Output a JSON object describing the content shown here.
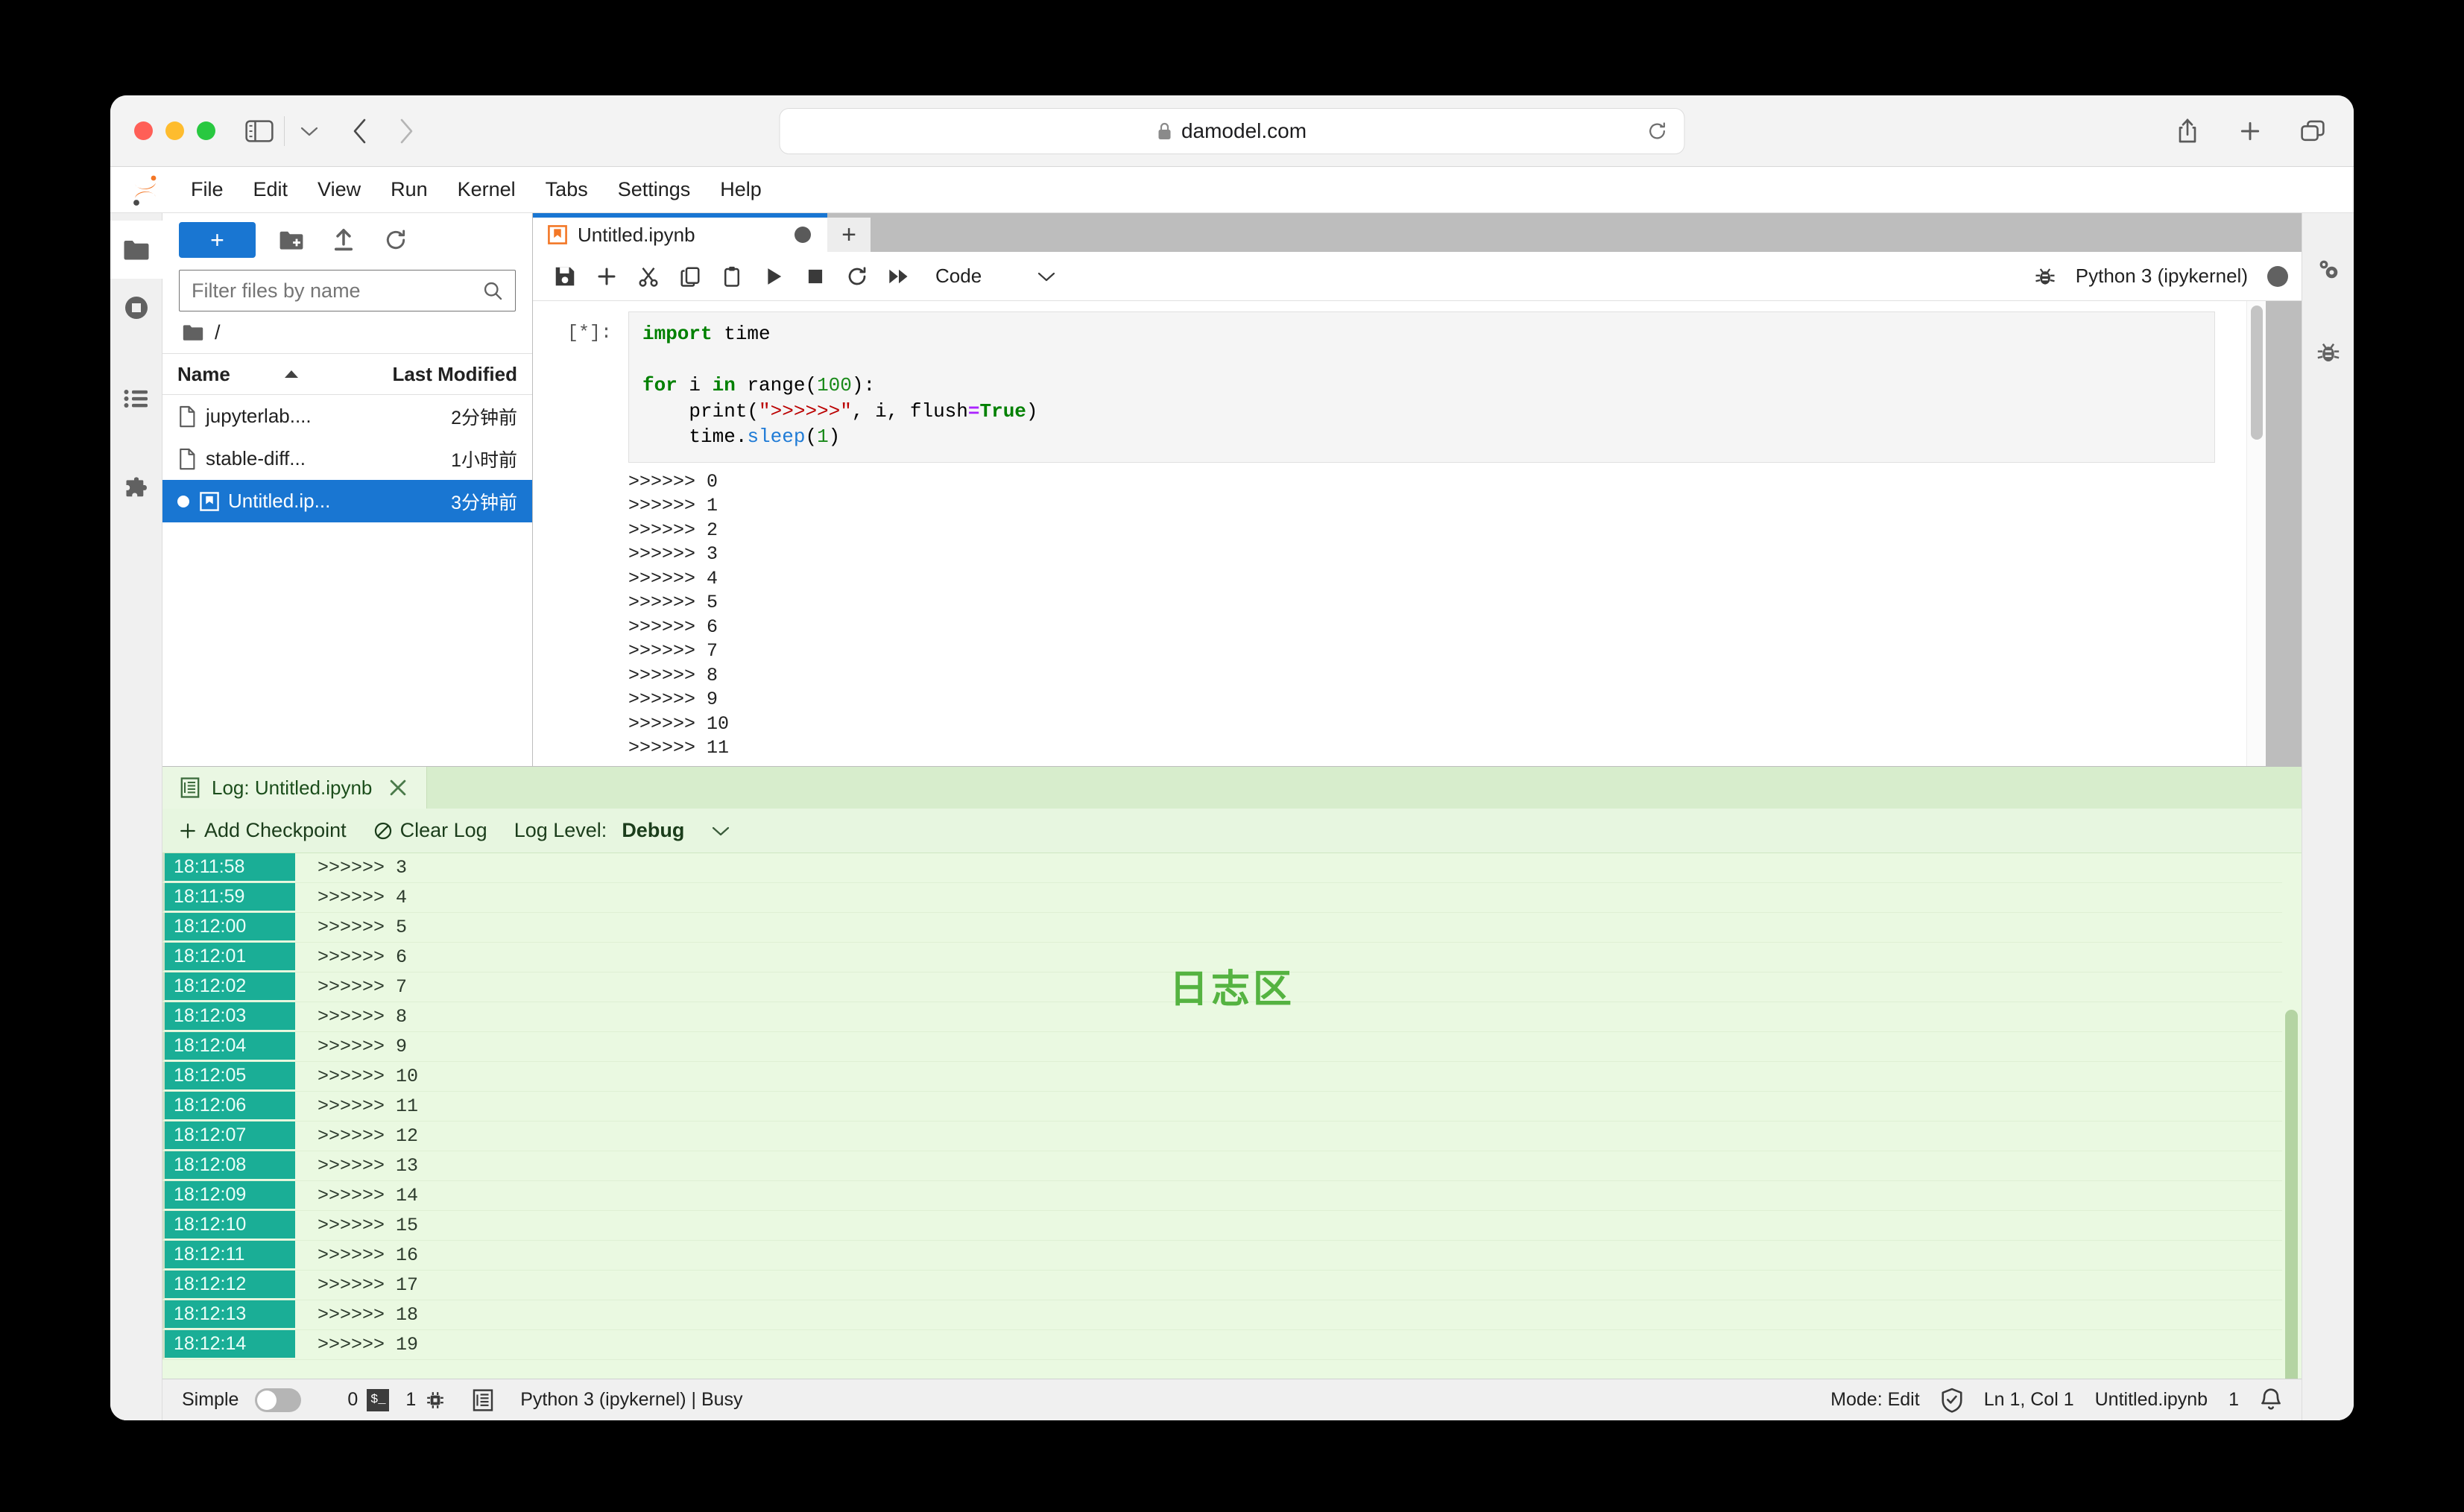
{
  "browser": {
    "url": "damodel.com",
    "lock_icon": "lock-icon",
    "reload_icon": "reload-icon",
    "sidebar_icon": "sidebar-toggle-icon",
    "back_icon": "back-arrow-icon",
    "forward_icon": "forward-arrow-icon",
    "share_icon": "share-icon",
    "newtab_icon": "plus-icon",
    "tabs_icon": "tab-overview-icon"
  },
  "menubar": {
    "items": [
      "File",
      "Edit",
      "View",
      "Run",
      "Kernel",
      "Tabs",
      "Settings",
      "Help"
    ]
  },
  "activity_bar": {
    "items": [
      {
        "name": "file-browser",
        "icon": "folder-icon"
      },
      {
        "name": "running-sessions",
        "icon": "stop-circle-icon"
      },
      {
        "name": "command-palette",
        "icon": "list-icon"
      },
      {
        "name": "extension-manager",
        "icon": "puzzle-icon"
      }
    ]
  },
  "right_sidebar": {
    "items": [
      {
        "name": "property-inspector",
        "icon": "gears-icon"
      },
      {
        "name": "debugger",
        "icon": "bug-icon"
      }
    ]
  },
  "filebrowser": {
    "new_launcher_label": "+",
    "new_folder_icon": "new-folder-icon",
    "upload_icon": "upload-icon",
    "refresh_icon": "refresh-icon",
    "filter_placeholder": "Filter files by name",
    "filter_value": "",
    "search_icon": "search-icon",
    "breadcrumb": "/",
    "breadcrumb_icon": "folder-icon",
    "columns": [
      "Name",
      "Last Modified"
    ],
    "sort_icon": "sort-ascending-icon",
    "files": [
      {
        "name": "jupyterlab....",
        "modified": "2分钟前",
        "icon": "file-icon",
        "selected": false,
        "running": false
      },
      {
        "name": "stable-diff...",
        "modified": "1小时前",
        "icon": "file-icon",
        "selected": false,
        "running": false
      },
      {
        "name": "Untitled.ip...",
        "modified": "3分钟前",
        "icon": "notebook-icon",
        "selected": true,
        "running": true
      }
    ]
  },
  "notebook": {
    "tab_title": "Untitled.ipynb",
    "tab_icon": "notebook-icon",
    "dirty_indicator": "unsaved-dot",
    "add_tab_label": "+",
    "toolbar": [
      {
        "name": "save-button",
        "icon": "save-icon"
      },
      {
        "name": "insert-cell-button",
        "icon": "plus-icon"
      },
      {
        "name": "cut-button",
        "icon": "scissors-icon"
      },
      {
        "name": "copy-button",
        "icon": "copy-icon"
      },
      {
        "name": "paste-button",
        "icon": "clipboard-icon"
      },
      {
        "name": "run-button",
        "icon": "play-icon"
      },
      {
        "name": "interrupt-button",
        "icon": "stop-icon"
      },
      {
        "name": "restart-button",
        "icon": "restart-icon"
      },
      {
        "name": "restart-run-all-button",
        "icon": "fast-forward-icon"
      }
    ],
    "celltype_value": "Code",
    "celltype_chevron": "chevron-down-icon",
    "debugger_icon": "bug-icon",
    "kernel_name": "Python 3 (ipykernel)",
    "kernel_status_dot": "busy-dot",
    "cell": {
      "prompt": "[*]:",
      "code_lines": [
        {
          "tokens": [
            {
              "t": "import",
              "c": "kw"
            },
            {
              "t": " time",
              "c": ""
            }
          ]
        },
        {
          "tokens": []
        },
        {
          "tokens": [
            {
              "t": "for",
              "c": "kw"
            },
            {
              "t": " i ",
              "c": ""
            },
            {
              "t": "in",
              "c": "kw"
            },
            {
              "t": " range(",
              "c": ""
            },
            {
              "t": "100",
              "c": "num"
            },
            {
              "t": "):",
              "c": ""
            }
          ]
        },
        {
          "tokens": [
            {
              "t": "    print(",
              "c": ""
            },
            {
              "t": "\">>>>>>\"",
              "c": "str"
            },
            {
              "t": ", i, flush",
              "c": ""
            },
            {
              "t": "=",
              "c": "op"
            },
            {
              "t": "True",
              "c": "kw"
            },
            {
              "t": ")",
              "c": ""
            }
          ]
        },
        {
          "tokens": [
            {
              "t": "    time.",
              "c": ""
            },
            {
              "t": "sleep",
              "c": "fn"
            },
            {
              "t": "(",
              "c": ""
            },
            {
              "t": "1",
              "c": "num"
            },
            {
              "t": ")",
              "c": ""
            }
          ]
        }
      ],
      "output_lines": [
        ">>>>>> 0",
        ">>>>>> 1",
        ">>>>>> 2",
        ">>>>>> 3",
        ">>>>>> 4",
        ">>>>>> 5",
        ">>>>>> 6",
        ">>>>>> 7",
        ">>>>>> 8",
        ">>>>>> 9",
        ">>>>>> 10",
        ">>>>>> 11"
      ]
    }
  },
  "log_panel": {
    "tab_title": "Log: Untitled.ipynb",
    "tab_icon": "log-icon",
    "close_icon": "close-icon",
    "add_checkpoint_label": "Add Checkpoint",
    "add_checkpoint_icon": "plus-icon",
    "clear_log_label": "Clear Log",
    "clear_log_icon": "ban-icon",
    "log_level_label": "Log Level:",
    "log_level_value": "Debug",
    "log_level_chevron": "chevron-down-icon",
    "overlay_text": "日志区",
    "overlay_color": "#55b341",
    "timestamp_bg": "#1aae96",
    "entries": [
      {
        "time": "18:11:58",
        "message": ">>>>>> 3"
      },
      {
        "time": "18:11:59",
        "message": ">>>>>> 4"
      },
      {
        "time": "18:12:00",
        "message": ">>>>>> 5"
      },
      {
        "time": "18:12:01",
        "message": ">>>>>> 6"
      },
      {
        "time": "18:12:02",
        "message": ">>>>>> 7"
      },
      {
        "time": "18:12:03",
        "message": ">>>>>> 8"
      },
      {
        "time": "18:12:04",
        "message": ">>>>>> 9"
      },
      {
        "time": "18:12:05",
        "message": ">>>>>> 10"
      },
      {
        "time": "18:12:06",
        "message": ">>>>>> 11"
      },
      {
        "time": "18:12:07",
        "message": ">>>>>> 12"
      },
      {
        "time": "18:12:08",
        "message": ">>>>>> 13"
      },
      {
        "time": "18:12:09",
        "message": ">>>>>> 14"
      },
      {
        "time": "18:12:10",
        "message": ">>>>>> 15"
      },
      {
        "time": "18:12:11",
        "message": ">>>>>> 16"
      },
      {
        "time": "18:12:12",
        "message": ">>>>>> 17"
      },
      {
        "time": "18:12:13",
        "message": ">>>>>> 18"
      },
      {
        "time": "18:12:14",
        "message": ">>>>>> 19"
      }
    ]
  },
  "statusbar": {
    "simple_label": "Simple",
    "toggle_state": "off",
    "terminal_count": "0",
    "terminal_icon": "terminal-icon",
    "kernel_count": "1",
    "kernel_icon": "chip-icon",
    "log_icon": "log-icon",
    "kernel_status": "Python 3 (ipykernel) | Busy",
    "mode": "Mode: Edit",
    "trust_icon": "shield-check-icon",
    "position": "Ln 1, Col 1",
    "filename": "Untitled.ipynb",
    "notification_count": "1",
    "bell_icon": "bell-icon"
  }
}
